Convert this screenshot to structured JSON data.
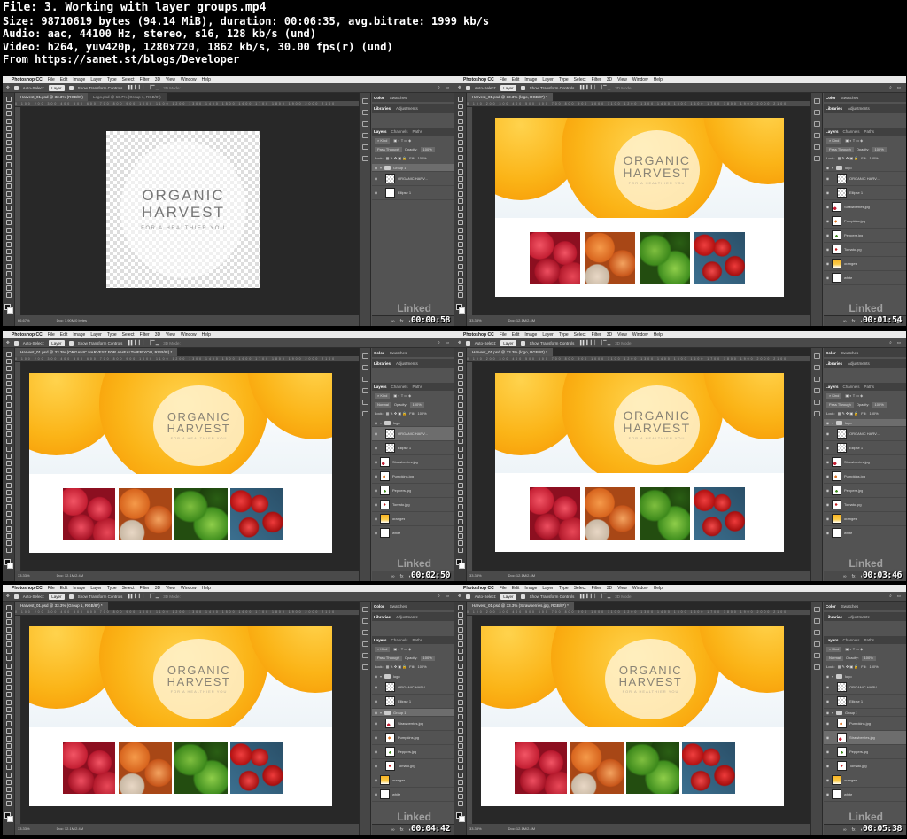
{
  "header": {
    "file": "File: 3. Working with layer groups.mp4",
    "size": "Size: 98710619 bytes (94.14 MiB), duration: 00:06:35, avg.bitrate: 1999 kb/s",
    "audio": "Audio: aac, 44100 Hz, stereo, s16, 128 kb/s (und)",
    "video": "Video: h264, yuv420p, 1280x720, 1862 kb/s, 30.00 fps(r) (und)",
    "from": "From https://sanet.st/blogs/Developer"
  },
  "app": {
    "apple": "",
    "name": "Photoshop CC",
    "menus": [
      "File",
      "Edit",
      "Image",
      "Layer",
      "Type",
      "Select",
      "Filter",
      "3D",
      "View",
      "Window",
      "Help"
    ]
  },
  "options": {
    "auto_select": "Auto-Select:",
    "layer_dropdown": "Layer",
    "show_transform": "Show Transform Controls",
    "mode_3d": "3D Mode:"
  },
  "panels": {
    "color_tab": "Color",
    "swatches_tab": "Swatches",
    "libraries_tab": "Libraries",
    "adjustments_tab": "Adjustments",
    "layers_tab": "Layers",
    "channels_tab": "Channels",
    "paths_tab": "Paths",
    "kind": "Kind",
    "opacity_label": "Opacity:",
    "fill_label": "Fill:",
    "lock_label": "Lock:",
    "hundred": "100%"
  },
  "logo_text": {
    "line1": "ORGANIC",
    "line2": "HARVEST",
    "tagline": "FOR A HEALTHIER YOU"
  },
  "tiles": [
    "strawberries",
    "pumpkins",
    "peppers",
    "tomatoes"
  ],
  "watermark": "Linked",
  "frames": [
    {
      "tab": "Harvest_01.psd @ 33.3% (RGB/8*)",
      "tab2": "Logo.psd @ 66.7% (Group 1, RGB/8*)",
      "zoom": "66.67%",
      "doc": "Doc: 1.90M/0 bytes",
      "blend": "Pass Through",
      "timestamp": "00:00:58",
      "layers": [
        {
          "name": "Group 1",
          "kind": "group",
          "selected": true,
          "indent": 0
        },
        {
          "name": "ORGANIC HARV...",
          "kind": "checker",
          "selected": false,
          "indent": 1
        },
        {
          "name": "Ellipse 1",
          "kind": "white",
          "selected": false,
          "indent": 1
        }
      ]
    },
    {
      "tab": "Harvest_01.psd @ 33.3% (logo, RGB/8*) *",
      "tab2": "",
      "zoom": "33.33%",
      "doc": "Doc: 12.1M/2.4M",
      "blend": "Pass Through",
      "timestamp": "00:01:54",
      "layers": [
        {
          "name": "logo",
          "kind": "group",
          "selected": false,
          "indent": 0
        },
        {
          "name": "ORGANIC HARV...",
          "kind": "checker",
          "selected": false,
          "indent": 1
        },
        {
          "name": "Ellipse 1",
          "kind": "checker",
          "selected": false,
          "indent": 1
        },
        {
          "name": "Strawberries.jpg",
          "kind": "strawberries",
          "selected": false,
          "indent": 0
        },
        {
          "name": "Pumpkins.jpg",
          "kind": "pumpkins",
          "selected": false,
          "indent": 0
        },
        {
          "name": "Peppers.jpg",
          "kind": "peppers",
          "selected": false,
          "indent": 0
        },
        {
          "name": "Tomato.jpg",
          "kind": "tomatoes",
          "selected": false,
          "indent": 0
        },
        {
          "name": "oranges",
          "kind": "orange",
          "selected": false,
          "indent": 0
        },
        {
          "name": "white",
          "kind": "white",
          "selected": false,
          "indent": 0
        }
      ]
    },
    {
      "tab": "Harvest_01.psd @ 33.3% (ORGANIC HARVEST FOR A HEALTHIER YOU, RGB/8*) *",
      "tab2": "",
      "zoom": "33.33%",
      "doc": "Doc: 12.1M/2.4M",
      "blend": "Normal",
      "timestamp": "00:02:50",
      "layers": [
        {
          "name": "logo",
          "kind": "group",
          "selected": false,
          "indent": 0
        },
        {
          "name": "ORGANIC HARV...",
          "kind": "checker",
          "selected": true,
          "indent": 1
        },
        {
          "name": "Ellipse 1",
          "kind": "checker",
          "selected": false,
          "indent": 1
        },
        {
          "name": "Strawberries.jpg",
          "kind": "strawberries",
          "selected": false,
          "indent": 0
        },
        {
          "name": "Pumpkins.jpg",
          "kind": "pumpkins",
          "selected": false,
          "indent": 0
        },
        {
          "name": "Peppers.jpg",
          "kind": "peppers",
          "selected": false,
          "indent": 0
        },
        {
          "name": "Tomato.jpg",
          "kind": "tomatoes",
          "selected": false,
          "indent": 0
        },
        {
          "name": "oranges",
          "kind": "orange",
          "selected": false,
          "indent": 0
        },
        {
          "name": "white",
          "kind": "white",
          "selected": false,
          "indent": 0
        }
      ]
    },
    {
      "tab": "Harvest_01.psd @ 33.3% (logo, RGB/8*) *",
      "tab2": "",
      "zoom": "33.33%",
      "doc": "Doc: 12.1M/2.4M",
      "blend": "Pass Through",
      "timestamp": "00:03:46",
      "layers": [
        {
          "name": "logo",
          "kind": "group",
          "selected": true,
          "indent": 0
        },
        {
          "name": "ORGANIC HARV...",
          "kind": "checker",
          "selected": false,
          "indent": 1
        },
        {
          "name": "Ellipse 1",
          "kind": "checker",
          "selected": false,
          "indent": 1
        },
        {
          "name": "Strawberries.jpg",
          "kind": "strawberries",
          "selected": false,
          "indent": 0
        },
        {
          "name": "Pumpkins.jpg",
          "kind": "pumpkins",
          "selected": false,
          "indent": 0
        },
        {
          "name": "Peppers.jpg",
          "kind": "peppers",
          "selected": false,
          "indent": 0
        },
        {
          "name": "Tomato.jpg",
          "kind": "tomatoes",
          "selected": false,
          "indent": 0
        },
        {
          "name": "oranges",
          "kind": "orange",
          "selected": false,
          "indent": 0
        },
        {
          "name": "white",
          "kind": "white",
          "selected": false,
          "indent": 0
        }
      ]
    },
    {
      "tab": "Harvest_01.psd @ 33.3% (Group 1, RGB/8*) *",
      "tab2": "",
      "zoom": "33.33%",
      "doc": "Doc: 12.1M/2.4M",
      "blend": "Pass Through",
      "timestamp": "00:04:42",
      "layers": [
        {
          "name": "logo",
          "kind": "group",
          "selected": false,
          "indent": 0
        },
        {
          "name": "ORGANIC HARV...",
          "kind": "checker",
          "selected": false,
          "indent": 1
        },
        {
          "name": "Ellipse 1",
          "kind": "checker",
          "selected": false,
          "indent": 1
        },
        {
          "name": "Group 1",
          "kind": "group",
          "selected": true,
          "indent": 0
        },
        {
          "name": "Strawberries.jpg",
          "kind": "strawberries",
          "selected": false,
          "indent": 1
        },
        {
          "name": "Pumpkins.jpg",
          "kind": "pumpkins",
          "selected": false,
          "indent": 1
        },
        {
          "name": "Peppers.jpg",
          "kind": "peppers",
          "selected": false,
          "indent": 1
        },
        {
          "name": "Tomato.jpg",
          "kind": "tomatoes",
          "selected": false,
          "indent": 1
        },
        {
          "name": "oranges",
          "kind": "orange",
          "selected": false,
          "indent": 0
        },
        {
          "name": "white",
          "kind": "white",
          "selected": false,
          "indent": 0
        }
      ]
    },
    {
      "tab": "Harvest_01.psd @ 33.3% (Strawberries.jpg, RGB/8*) *",
      "tab2": "",
      "zoom": "33.33%",
      "doc": "Doc: 12.1M/2.4M",
      "blend": "Normal",
      "timestamp": "00:05:38",
      "layers": [
        {
          "name": "logo",
          "kind": "group",
          "selected": false,
          "indent": 0
        },
        {
          "name": "ORGANIC HARV...",
          "kind": "checker",
          "selected": false,
          "indent": 1
        },
        {
          "name": "Ellipse 1",
          "kind": "checker",
          "selected": false,
          "indent": 1
        },
        {
          "name": "Group 1",
          "kind": "group",
          "selected": false,
          "indent": 0
        },
        {
          "name": "Pumpkins.jpg",
          "kind": "pumpkins",
          "selected": false,
          "indent": 1
        },
        {
          "name": "Strawberries.jpg",
          "kind": "strawberries",
          "selected": true,
          "indent": 1
        },
        {
          "name": "Peppers.jpg",
          "kind": "peppers",
          "selected": false,
          "indent": 1
        },
        {
          "name": "Tomato.jpg",
          "kind": "tomatoes",
          "selected": false,
          "indent": 1
        },
        {
          "name": "oranges",
          "kind": "orange",
          "selected": false,
          "indent": 0
        },
        {
          "name": "white",
          "kind": "white",
          "selected": false,
          "indent": 0
        }
      ]
    }
  ]
}
